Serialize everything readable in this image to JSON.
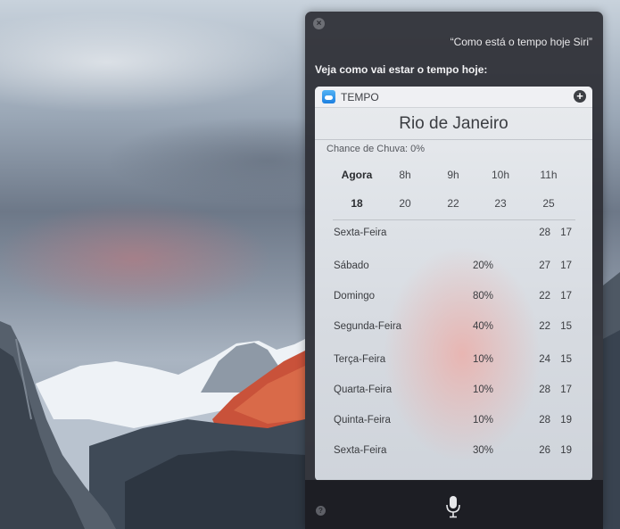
{
  "siri": {
    "query": "“Como está o tempo hoje Siri”",
    "response": "Veja como vai estar o tempo hoje:"
  },
  "card": {
    "app_name": "TEMPO",
    "city": "Rio de Janeiro",
    "rain_chance": "Chance de Chuva: 0%",
    "hourly": [
      {
        "time": "Agora",
        "temp": "18"
      },
      {
        "time": "8h",
        "temp": "20"
      },
      {
        "time": "9h",
        "temp": "22"
      },
      {
        "time": "10h",
        "temp": "23"
      },
      {
        "time": "11h",
        "temp": "25"
      }
    ],
    "daily": [
      {
        "day": "Sexta-Feira",
        "rain": "",
        "high": "28",
        "low": "17"
      },
      {
        "day": "Sábado",
        "rain": "20%",
        "high": "27",
        "low": "17"
      },
      {
        "day": "Domingo",
        "rain": "80%",
        "high": "22",
        "low": "17"
      },
      {
        "day": "Segunda-Feira",
        "rain": "40%",
        "high": "22",
        "low": "15"
      },
      {
        "day": "Terça-Feira",
        "rain": "10%",
        "high": "24",
        "low": "15"
      },
      {
        "day": "Quarta-Feira",
        "rain": "10%",
        "high": "28",
        "low": "17"
      },
      {
        "day": "Quinta-Feira",
        "rain": "10%",
        "high": "28",
        "low": "19"
      },
      {
        "day": "Sexta-Feira",
        "rain": "30%",
        "high": "26",
        "low": "19"
      }
    ]
  },
  "icons": {
    "close": "close-icon",
    "add": "plus-circle-icon",
    "app": "weather-app-icon",
    "mic": "microphone-icon",
    "help": "question-mark-icon"
  },
  "colors": {
    "panel_bg": "#2c2e34",
    "card_bg": "#e3e6ea",
    "app_icon_blue": "#2a8ee8"
  }
}
